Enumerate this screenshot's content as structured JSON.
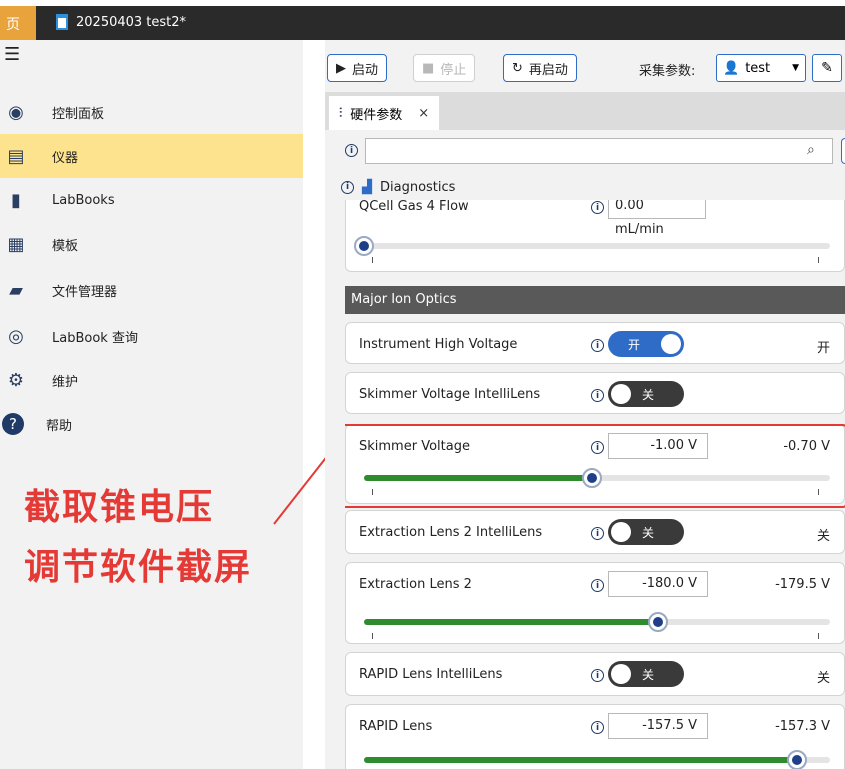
{
  "titlebar": {
    "home_label": "页",
    "doc_title": "20250403 test2*"
  },
  "sidebar": {
    "menu_icon": "hamburger-icon",
    "items": [
      {
        "label": "控制面板",
        "icon": "dashboard-icon"
      },
      {
        "label": "仪器",
        "icon": "instrument-icon",
        "active": true
      },
      {
        "label": "LabBooks",
        "icon": "labbooks-icon"
      },
      {
        "label": "模板",
        "icon": "template-icon"
      },
      {
        "label": "文件管理器",
        "icon": "folder-icon"
      },
      {
        "label": "LabBook 查询",
        "icon": "query-icon"
      },
      {
        "label": "维护",
        "icon": "maintenance-icon"
      },
      {
        "label": "帮助",
        "icon": "help-icon"
      }
    ]
  },
  "annotation": {
    "line1": "截取锥电压",
    "line2": "调节软件截屏",
    "color": "#e53935"
  },
  "toolbar": {
    "start_label": "启动",
    "stop_label": "停止",
    "restart_label": "再启动",
    "acq_label": "采集参数:",
    "acq_value": "test"
  },
  "tab": {
    "label": "硬件参数",
    "close": "×"
  },
  "search": {
    "value": ""
  },
  "diagnostics": {
    "label": "Diagnostics"
  },
  "params": {
    "qcell": {
      "name": "QCell Gas 4 Flow",
      "value": "0.00 mL/min",
      "slider_fraction": 0.0
    },
    "section_title": "Major Ion Optics",
    "ihv": {
      "name": "Instrument High Voltage",
      "toggle": "开",
      "readback": "开"
    },
    "skimmer_il": {
      "name": "Skimmer Voltage IntelliLens",
      "toggle": "关"
    },
    "skimmer": {
      "name": "Skimmer Voltage",
      "value": "-1.00 V",
      "readback": "-0.70 V",
      "slider_fraction": 0.49
    },
    "ext2_il": {
      "name": "Extraction Lens 2 IntelliLens",
      "toggle": "关",
      "readback": "关"
    },
    "ext2": {
      "name": "Extraction Lens 2",
      "value": "-180.0 V",
      "readback": "-179.5 V",
      "slider_fraction": 0.63
    },
    "rapid_il": {
      "name": "RAPID Lens IntelliLens",
      "toggle": "关",
      "readback": "关"
    },
    "rapid": {
      "name": "RAPID Lens",
      "value": "-157.5 V",
      "readback": "-157.3 V",
      "slider_fraction": 0.93
    }
  }
}
